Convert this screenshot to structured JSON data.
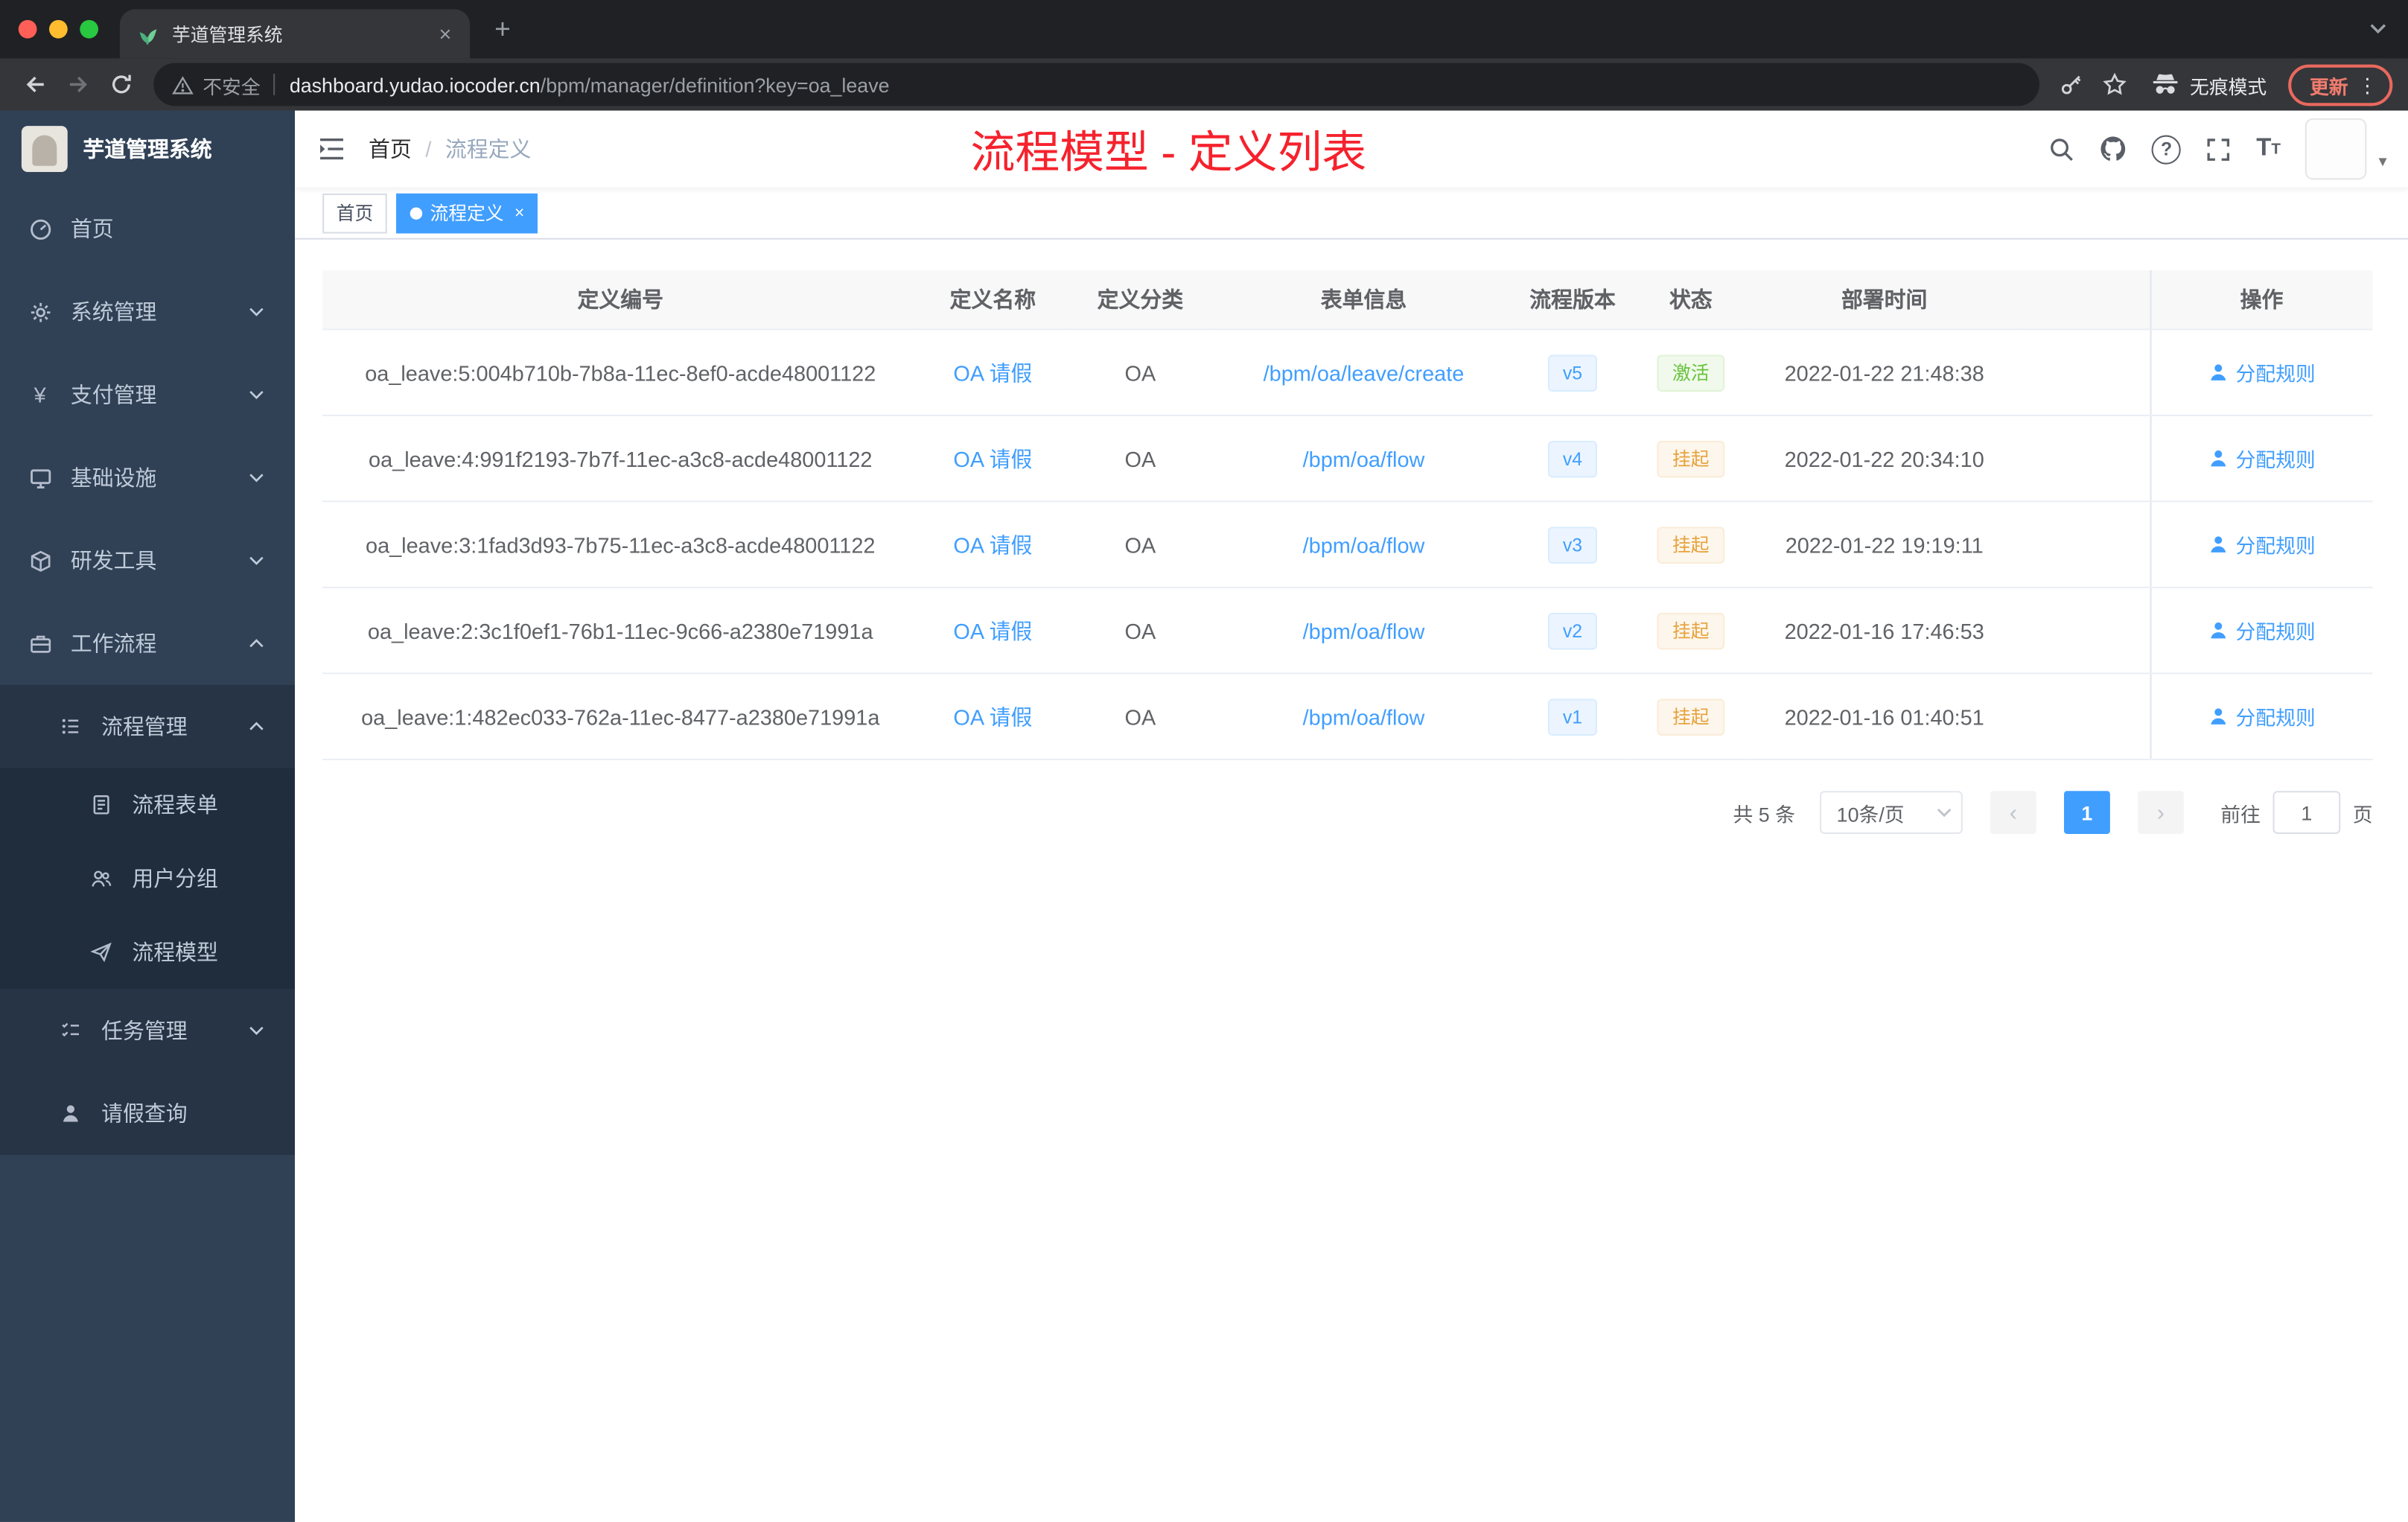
{
  "colors": {
    "accent": "#409eff",
    "success": "#67c23a",
    "warning": "#e6a23c",
    "annotation_red": "#f5222d",
    "sidebar_bg": "#304156"
  },
  "browser": {
    "tab_title": "芋道管理系统",
    "security_label": "不安全",
    "url_domain": "dashboard.yudao.iocoder.cn",
    "url_path": "/bpm/manager/definition?key=oa_leave",
    "incognito_label": "无痕模式",
    "update_label": "更新"
  },
  "sidebar": {
    "logo_title": "芋道管理系统",
    "items": [
      {
        "label": "首页"
      },
      {
        "label": "系统管理"
      },
      {
        "label": "支付管理"
      },
      {
        "label": "基础设施"
      },
      {
        "label": "研发工具"
      },
      {
        "label": "工作流程"
      },
      {
        "label": "流程管理"
      },
      {
        "label": "流程表单"
      },
      {
        "label": "用户分组"
      },
      {
        "label": "流程模型"
      },
      {
        "label": "任务管理"
      },
      {
        "label": "请假查询"
      }
    ]
  },
  "header": {
    "breadcrumb_home": "首页",
    "breadcrumb_current": "流程定义",
    "annotation": "流程模型 - 定义列表"
  },
  "tags": {
    "home": "首页",
    "active": "流程定义"
  },
  "table": {
    "columns": [
      "定义编号",
      "定义名称",
      "定义分类",
      "表单信息",
      "流程版本",
      "状态",
      "部署时间",
      "操作"
    ],
    "rows": [
      {
        "id": "oa_leave:5:004b710b-7b8a-11ec-8ef0-acde48001122",
        "name": "OA 请假",
        "category": "OA",
        "form": "/bpm/oa/leave/create",
        "version": "v5",
        "status": "激活",
        "time": "2022-01-22 21:48:38",
        "action": "分配规则"
      },
      {
        "id": "oa_leave:4:991f2193-7b7f-11ec-a3c8-acde48001122",
        "name": "OA 请假",
        "category": "OA",
        "form": "/bpm/oa/flow",
        "version": "v4",
        "status": "挂起",
        "time": "2022-01-22 20:34:10",
        "action": "分配规则"
      },
      {
        "id": "oa_leave:3:1fad3d93-7b75-11ec-a3c8-acde48001122",
        "name": "OA 请假",
        "category": "OA",
        "form": "/bpm/oa/flow",
        "version": "v3",
        "status": "挂起",
        "time": "2022-01-22 19:19:11",
        "action": "分配规则"
      },
      {
        "id": "oa_leave:2:3c1f0ef1-76b1-11ec-9c66-a2380e71991a",
        "name": "OA 请假",
        "category": "OA",
        "form": "/bpm/oa/flow",
        "version": "v2",
        "status": "挂起",
        "time": "2022-01-16 17:46:53",
        "action": "分配规则"
      },
      {
        "id": "oa_leave:1:482ec033-762a-11ec-8477-a2380e71991a",
        "name": "OA 请假",
        "category": "OA",
        "form": "/bpm/oa/flow",
        "version": "v1",
        "status": "挂起",
        "time": "2022-01-16 01:40:51",
        "action": "分配规则"
      }
    ]
  },
  "pagination": {
    "total": "共 5 条",
    "page_size": "10条/页",
    "current_page": "1",
    "goto_label": "前往",
    "page_unit": "页"
  }
}
